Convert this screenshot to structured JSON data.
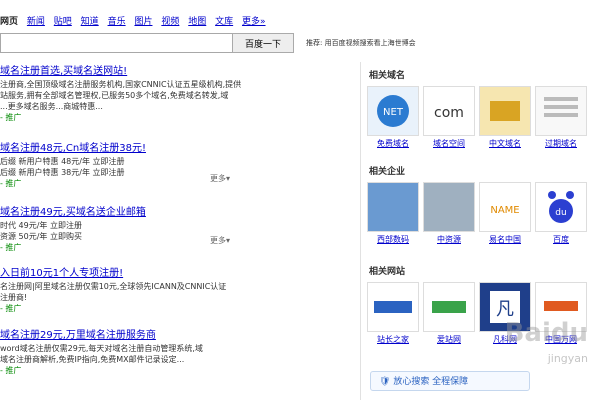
{
  "nav": [
    "网页",
    "新闻",
    "贴吧",
    "知道",
    "音乐",
    "图片",
    "视频",
    "地图",
    "文库",
    "更多»"
  ],
  "search": {
    "button": "百度一下",
    "tip": "推荐: 用百度视频搜索看上海世博会"
  },
  "results": [
    {
      "title": "域名注册首选,买域名送网站!",
      "desc1": "注册商,全国顶级域名注册服务机构,国家CNNIC认证五星级机构,提供",
      "desc2": "站服务,拥有全部域名管理权,已服务50多个域名,免费域名转发,域",
      "desc3": "...更多域名服务...商城特惠...",
      "link": "- 推广"
    },
    {
      "title": "域名注册48元,Cn域名注册38元!",
      "desc1": "后缀  新用户特惠  48元/年  立即注册",
      "desc2": "后缀  新用户特惠  38元/年  立即注册",
      "desc3": "",
      "link": "- 推广",
      "more": "更多▾"
    },
    {
      "title": "域名注册49元,买域名送企业邮箱",
      "desc1": "时代  49元/年  立即注册",
      "desc2": "资源  50元/年  立即购买",
      "desc3": "",
      "link": "- 推广",
      "more": "更多▾"
    },
    {
      "title": "入日前10元1个人专项注册!",
      "desc1": "名注册网|阿里域名注册仅需10元,全球领先ICANN及CNNIC认证",
      "desc2": "注册商!",
      "desc3": "",
      "link": "- 推广"
    },
    {
      "title": "域名注册29元,万里域名注册服务商",
      "desc1": "word域名注册仅需29元,每天对域名注册自动管理系统,域",
      "desc2": "域名注册商解析,免费IP指向,免费MX邮件记录设定...",
      "desc3": "",
      "link": "- 推广"
    }
  ],
  "sidebar": {
    "sections": [
      {
        "title": "相关域名",
        "items": [
          "免费域名",
          "域名空间",
          "中文域名",
          "过期域名"
        ]
      },
      {
        "title": "相关企业",
        "items": [
          "西部数码",
          "中资源",
          "易名中国",
          "百度"
        ]
      },
      {
        "title": "相关网站",
        "items": [
          "站长之家",
          "爱站网",
          "凡科网",
          "中国万网"
        ]
      }
    ],
    "safe_search": "放心搜索  全程保障"
  },
  "watermark": {
    "logo": "Baidu",
    "sub": "jingyan"
  },
  "colors": {
    "link": "#0000cc",
    "url_green": "#008000",
    "tile_blue": "#2b63c1"
  }
}
